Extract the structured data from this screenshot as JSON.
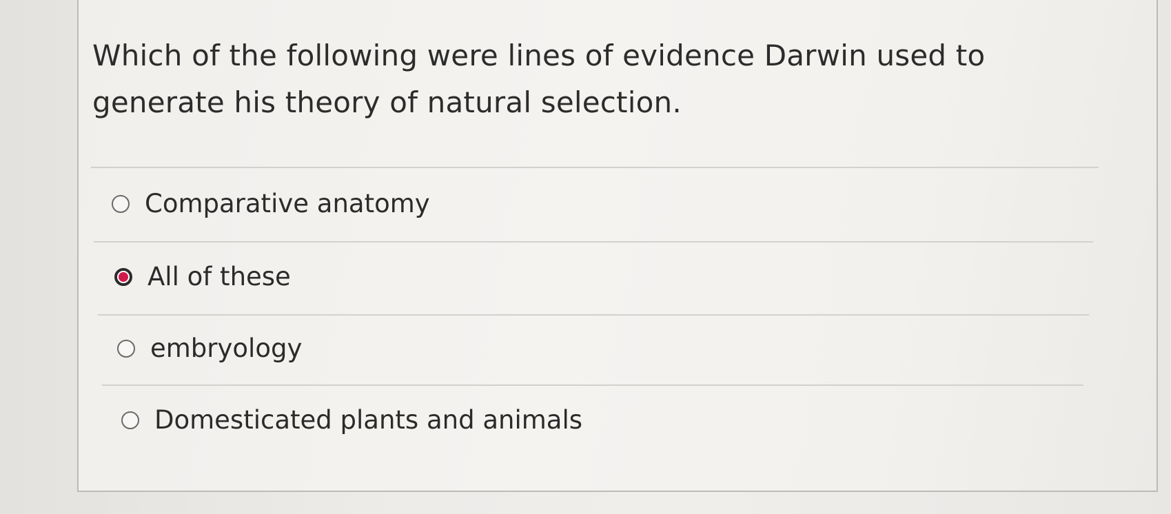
{
  "question": {
    "text": "Which of the following were lines of evidence Darwin used to generate his theory of natural selection."
  },
  "options": [
    {
      "label": "Comparative anatomy",
      "selected": false
    },
    {
      "label": "All of these",
      "selected": true
    },
    {
      "label": "embryology",
      "selected": false
    },
    {
      "label": "Domesticated plants and animals",
      "selected": false
    }
  ],
  "colors": {
    "selected_accent": "#d01a4a",
    "border": "#bdbbb8",
    "divider": "#d3d1ce"
  }
}
